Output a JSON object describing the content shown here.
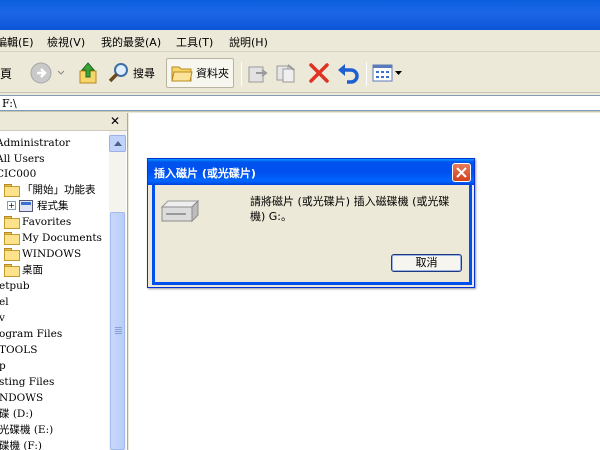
{
  "menu": {
    "items": [
      "編輯(E)",
      "檢視(V)",
      "我的最愛(A)",
      "工具(T)",
      "說明(H)"
    ]
  },
  "toolbar": {
    "search_label": "搜尋",
    "folders_label": "資料夾"
  },
  "address": {
    "value": "F:\\"
  },
  "folder_tree": {
    "items": [
      "Administrator",
      "All Users",
      "CIC000",
      "「開始」功能表",
      "程式集",
      "Favorites",
      "My Documents",
      "WINDOWS",
      "桌面",
      "etpub",
      "el",
      "v",
      "ogram Files",
      "TOOLS",
      "p",
      "sting Files",
      "NDOWS",
      "碟 (D:)",
      "光碟機 (E:)",
      "碟機 (F:)"
    ]
  },
  "dialog": {
    "title": "插入磁片 (或光碟片)",
    "message": "請將磁片 (或光碟片) 插入磁碟機 (或光碟機) G:。",
    "cancel_label": "取消"
  },
  "colors": {
    "xp_blue": "#0050ee",
    "close_red": "#d2401a",
    "window_bg": "#ece9d8"
  }
}
